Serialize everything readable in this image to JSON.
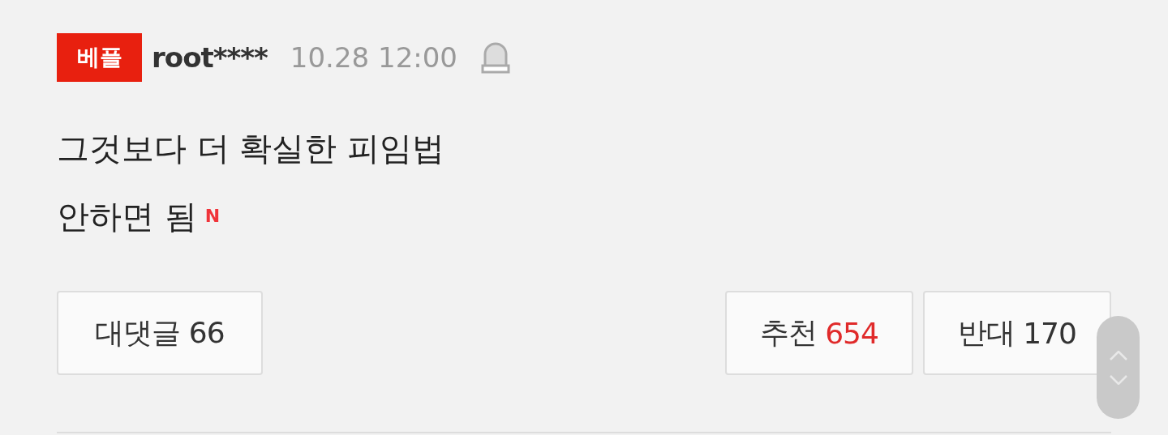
{
  "comment": {
    "badge": "베플",
    "author": "root****",
    "time": "10.28 12:00",
    "lines": [
      "그것보다 더 확실한 피임법",
      "안하면 됨"
    ],
    "new_mark": "N",
    "reply_button": {
      "label": "대댓글",
      "count": "66"
    },
    "votes": [
      {
        "kind": "up",
        "label": "추천",
        "count": "654"
      },
      {
        "kind": "down",
        "label": "반대",
        "count": "170"
      }
    ]
  }
}
